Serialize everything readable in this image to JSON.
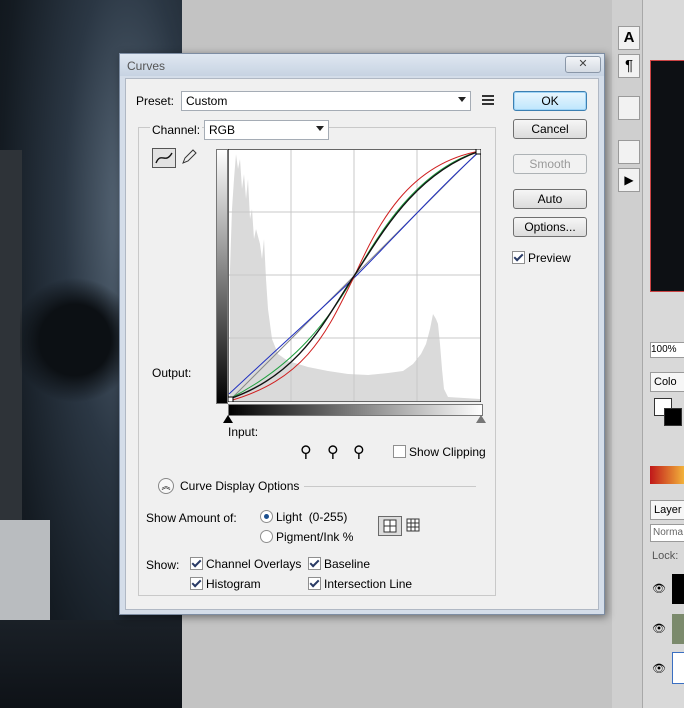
{
  "dialog": {
    "title": "Curves",
    "close_glyph": "✕",
    "preset_label": "Preset:",
    "preset_value": "Custom",
    "channel_label": "Channel:",
    "channel_value": "RGB",
    "output_label": "Output:",
    "input_label": "Input:",
    "buttons": {
      "ok": "OK",
      "cancel": "Cancel",
      "smooth": "Smooth",
      "auto": "Auto",
      "options": "Options..."
    },
    "preview": {
      "label": "Preview",
      "checked": true
    },
    "show_clipping": {
      "label": "Show Clipping",
      "checked": false
    },
    "curve_display_options": "Curve Display Options",
    "show_amount_label": "Show Amount of:",
    "show_amount_options": [
      {
        "label": "Light  (0-255)",
        "selected": true
      },
      {
        "label": "Pigment/Ink %",
        "selected": false
      }
    ],
    "show_label": "Show:",
    "show_options": {
      "channel_overlays": {
        "label": "Channel Overlays",
        "checked": true
      },
      "baseline": {
        "label": "Baseline",
        "checked": true
      },
      "histogram": {
        "label": "Histogram",
        "checked": true
      },
      "intersection_line": {
        "label": "Intersection Line",
        "checked": true
      }
    }
  },
  "right_panel": {
    "zoom": "100%",
    "color_tab": "Colo",
    "layers_tab": "Layer",
    "blend_mode": "Norma",
    "lock_label": "Lock:"
  },
  "colors": {
    "dialog_bg": "#f0f0f0",
    "titlebar": "#d4dde9",
    "curve_rgb": "#111111",
    "curve_red": "#d02020",
    "curve_green": "#20a040",
    "curve_blue": "#2030c0",
    "histogram": "#dadada"
  }
}
